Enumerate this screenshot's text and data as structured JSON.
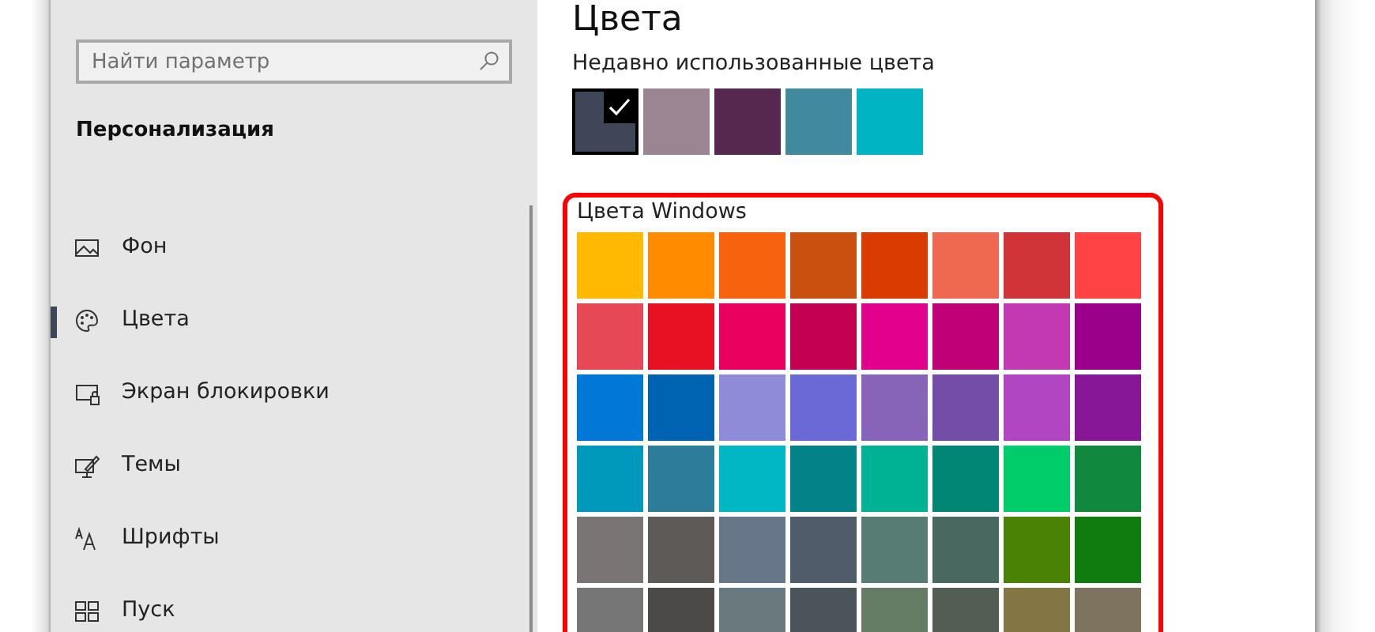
{
  "page_title": "Цвета",
  "sidebar": {
    "search": {
      "placeholder": "Найти параметр"
    },
    "section": "Персонализация",
    "items": [
      {
        "label": "Фон",
        "kind": "image",
        "selected": false
      },
      {
        "label": "Цвета",
        "kind": "palette",
        "selected": true
      },
      {
        "label": "Экран блокировки",
        "kind": "lock",
        "selected": false
      },
      {
        "label": "Темы",
        "kind": "theme",
        "selected": false
      },
      {
        "label": "Шрифты",
        "kind": "font",
        "selected": false
      },
      {
        "label": "Пуск",
        "kind": "start",
        "selected": false
      }
    ]
  },
  "recent_colors": {
    "label": "Недавно использованные цвета",
    "swatches": [
      {
        "color": "#3f4658",
        "selected": true
      },
      {
        "color": "#9b8593",
        "selected": false
      },
      {
        "color": "#56284f",
        "selected": false
      },
      {
        "color": "#418a9e",
        "selected": false
      },
      {
        "color": "#00b4c3",
        "selected": false
      }
    ]
  },
  "windows_colors": {
    "label": "Цвета Windows",
    "rows": [
      [
        {
          "color": "#ffb900"
        },
        {
          "color": "#ff8c00"
        },
        {
          "color": "#f7630c"
        },
        {
          "color": "#ca5010"
        },
        {
          "color": "#da3b01"
        },
        {
          "color": "#ef6950"
        },
        {
          "color": "#d13438"
        },
        {
          "color": "#ff4343"
        }
      ],
      [
        {
          "color": "#e74856"
        },
        {
          "color": "#e81123"
        },
        {
          "color": "#ea005e"
        },
        {
          "color": "#c30052"
        },
        {
          "color": "#e3008c"
        },
        {
          "color": "#bf0077"
        },
        {
          "color": "#c239b3"
        },
        {
          "color": "#9a0089"
        }
      ],
      [
        {
          "color": "#0078d7"
        },
        {
          "color": "#0063b1"
        },
        {
          "color": "#8e8cd8"
        },
        {
          "color": "#6b69d6"
        },
        {
          "color": "#8764b8"
        },
        {
          "color": "#744da9"
        },
        {
          "color": "#b146c2"
        },
        {
          "color": "#881798"
        }
      ],
      [
        {
          "color": "#0099bc"
        },
        {
          "color": "#2d7d9a"
        },
        {
          "color": "#00b7c3"
        },
        {
          "color": "#038387"
        },
        {
          "color": "#00b294"
        },
        {
          "color": "#018574"
        },
        {
          "color": "#00cc6a"
        },
        {
          "color": "#10893e"
        }
      ],
      [
        {
          "color": "#7a7574"
        },
        {
          "color": "#5d5a58"
        },
        {
          "color": "#68768a"
        },
        {
          "color": "#515c6b"
        },
        {
          "color": "#567c73"
        },
        {
          "color": "#486860"
        },
        {
          "color": "#498205"
        },
        {
          "color": "#107c10"
        }
      ],
      [
        {
          "color": "#767676"
        },
        {
          "color": "#4c4a48"
        },
        {
          "color": "#69797e"
        },
        {
          "color": "#4a5459"
        },
        {
          "color": "#647c64"
        },
        {
          "color": "#525e54"
        },
        {
          "color": "#847545"
        },
        {
          "color": "#7e735f"
        }
      ]
    ]
  }
}
